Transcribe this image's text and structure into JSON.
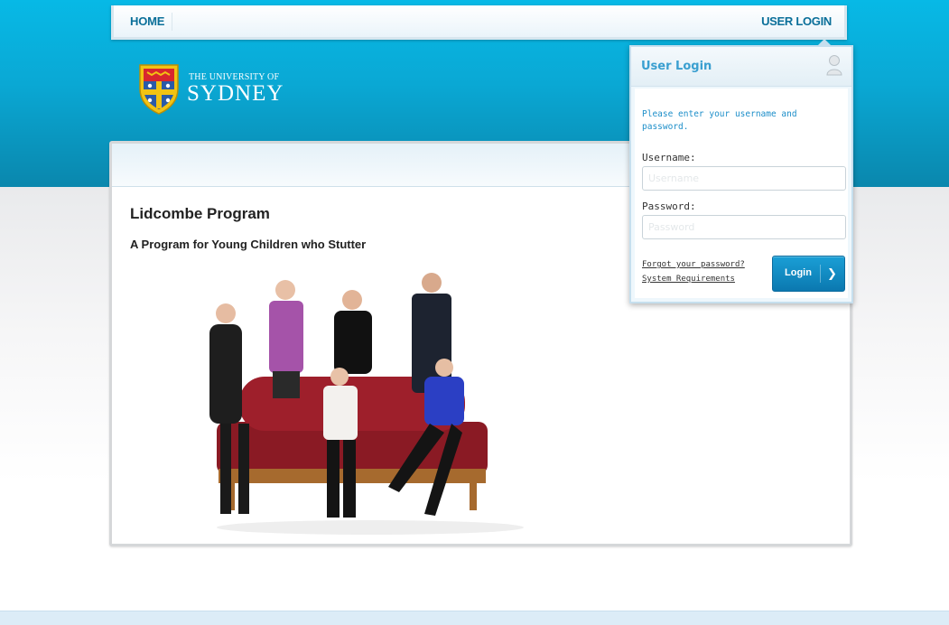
{
  "nav": {
    "home_label": "HOME",
    "login_label": "USER LOGIN"
  },
  "logo": {
    "small_text": "THE UNIVERSITY OF",
    "big_text": "SYDNEY"
  },
  "main": {
    "title": "Lidcombe Program",
    "subtitle": "A Program for Young Children who Stutter"
  },
  "login": {
    "title": "User Login",
    "message": "Please enter your username and password.",
    "username_label": "Username:",
    "username_placeholder": "Username",
    "password_label": "Password:",
    "password_placeholder": "Password",
    "forgot_link": "Forgot your password?",
    "requirements_link": "System Requirements",
    "button_label": "Login"
  },
  "colors": {
    "header_blue": "#07b9e6",
    "accent_blue": "#1c8ec9",
    "button_blue": "#0b78b0"
  },
  "icons": [
    "user-avatar-icon",
    "chevron-right-icon",
    "university-crest-icon"
  ]
}
